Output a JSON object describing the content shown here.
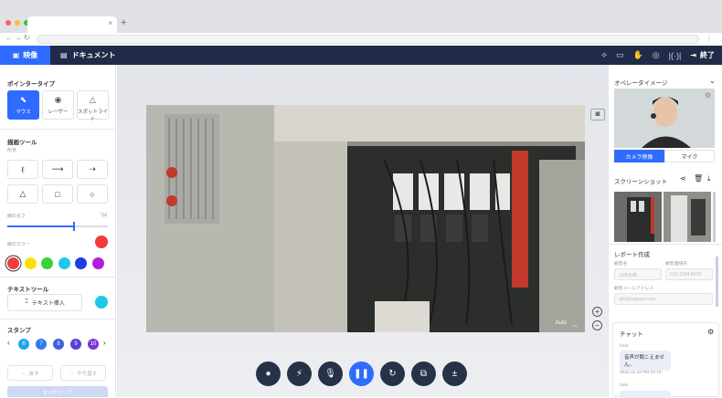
{
  "browser": {
    "tab_label": "",
    "close": "×",
    "newtab": "+"
  },
  "header": {
    "video_tab": "映像",
    "doc_tab": "ドキュメント",
    "end_label": "終了",
    "signal": "|(·)|"
  },
  "left": {
    "pointer_title": "ポインタータイプ",
    "pointer_buttons": [
      "マウス",
      "レーザー",
      "スポットライト"
    ],
    "draw_title": "描画ツール",
    "draw_sub": "形状",
    "thickness_label": "線の太さ",
    "thickness_value": "7pt",
    "thickness_fraction": 0.66,
    "color_label": "線のカラー",
    "palette": [
      "#f23b3b",
      "#ffe100",
      "#39d23a",
      "#1ec7e6",
      "#1e3ddc",
      "#b21fd9"
    ],
    "selected_color": "#f23b3b",
    "text_title": "テキストツール",
    "text_button": "テキスト挿入",
    "text_color": "#1ec7e6",
    "stamp_title": "スタンプ",
    "stamps": [
      "6",
      "7",
      "8",
      "9",
      "10"
    ],
    "stamp_colors": [
      "#1ea7f0",
      "#2f7bf0",
      "#3b5fe0",
      "#5a3fd8",
      "#7a36d2"
    ],
    "undo_label": "戻す",
    "redo_label": "やり直す",
    "clear_label": "すべてクリア"
  },
  "stage": {
    "auto_label": "Auto",
    "controls": [
      "pointer",
      "flash-off",
      "mic-off",
      "pause",
      "rotate",
      "capture",
      "brightness"
    ]
  },
  "right": {
    "operator_title": "オペレータイメージ",
    "camera_tab": "カメラ映像",
    "mic_tab": "マイク",
    "screenshot_title": "スクリーンショット",
    "report_title": "レポート作成",
    "name_label": "顧客名",
    "name_placeholder": "山田太郎",
    "phone_label": "顧客連絡先",
    "phone_placeholder": "010-1234-5678",
    "email_label": "顧客メールアドレス",
    "email_placeholder": "abc@support.com",
    "chat_title": "チャット",
    "messages": [
      {
        "sender": "host",
        "text": "音声が聞こえません。",
        "time": "2022.11.24 PM 16:15"
      },
      {
        "sender": "host",
        "text": "",
        "time": ""
      }
    ]
  }
}
